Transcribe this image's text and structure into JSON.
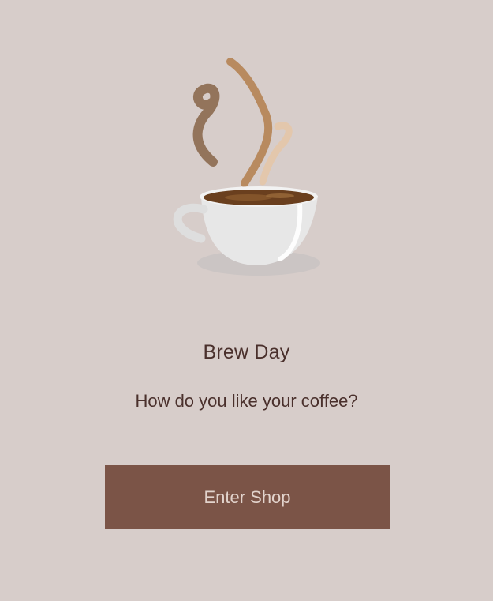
{
  "app": {
    "title": "Brew Day",
    "subtitle": "How do you like your coffee?"
  },
  "hero": {
    "icon": "coffee-cup-icon"
  },
  "actions": {
    "enter_label": "Enter Shop"
  },
  "colors": {
    "background": "#d7cdca",
    "text": "#4a302c",
    "button": "#7b5447",
    "button_text": "#e2d3cc"
  }
}
